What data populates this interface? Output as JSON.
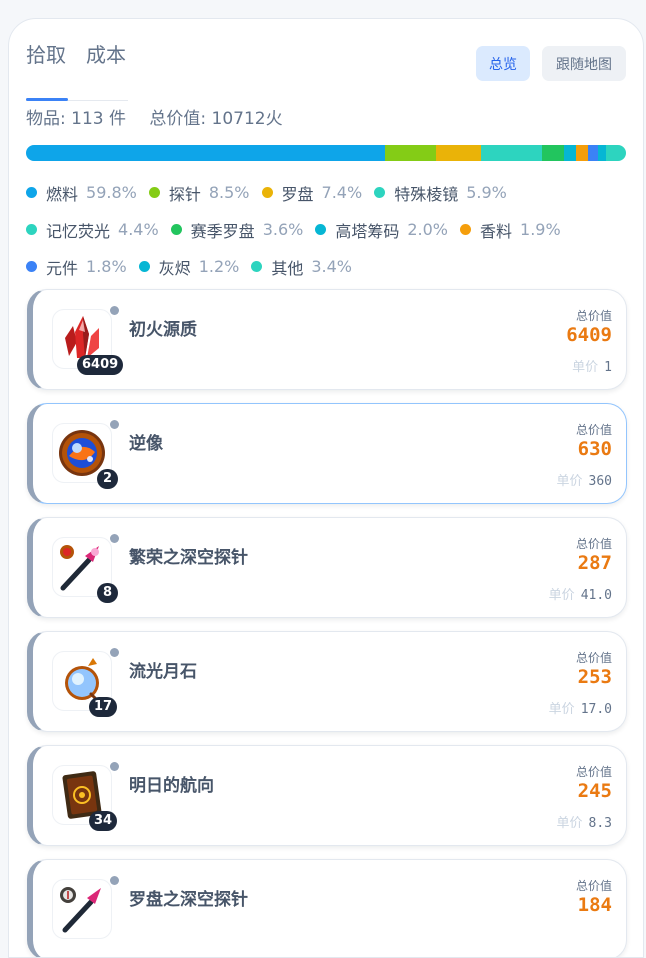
{
  "tabs": [
    {
      "label": "拾取",
      "active": true
    },
    {
      "label": "成本",
      "active": false
    }
  ],
  "buttons": {
    "overview": "总览",
    "follow_map": "跟随地图"
  },
  "summary": {
    "items_text": "物品: 113 件",
    "total_text": "总价值: 10712火"
  },
  "composition": [
    {
      "label": "燃料",
      "pct": "59.8%",
      "value": 59.8,
      "color": "#0ea5e9"
    },
    {
      "label": "探针",
      "pct": "8.5%",
      "value": 8.5,
      "color": "#84cc16"
    },
    {
      "label": "罗盘",
      "pct": "7.4%",
      "value": 7.4,
      "color": "#eab308"
    },
    {
      "label": "特殊棱镜",
      "pct": "5.9%",
      "value": 5.9,
      "color": "#2dd4bf"
    },
    {
      "label": "记忆荧光",
      "pct": "4.4%",
      "value": 4.4,
      "color": "#2dd4bf"
    },
    {
      "label": "赛季罗盘",
      "pct": "3.6%",
      "value": 3.6,
      "color": "#22c55e"
    },
    {
      "label": "高塔筹码",
      "pct": "2.0%",
      "value": 2.0,
      "color": "#06b6d4"
    },
    {
      "label": "香料",
      "pct": "1.9%",
      "value": 1.9,
      "color": "#f59e0b"
    },
    {
      "label": "元件",
      "pct": "1.8%",
      "value": 1.8,
      "color": "#3b82f6"
    },
    {
      "label": "灰烬",
      "pct": "1.2%",
      "value": 1.2,
      "color": "#06b6d4"
    },
    {
      "label": "其他",
      "pct": "3.4%",
      "value": 3.4,
      "color": "#2dd4bf"
    }
  ],
  "item_card_labels": {
    "total_value": "总价值",
    "unit_price": "单价"
  },
  "items": [
    {
      "name": "初火源质",
      "qty": "6409",
      "total": "6409",
      "unit": "1",
      "icon": "red-crystal-icon"
    },
    {
      "name": "逆像",
      "qty": "2",
      "total": "630",
      "unit": "360",
      "icon": "mirror-orb-icon"
    },
    {
      "name": "繁荣之深空探针",
      "qty": "8",
      "total": "287",
      "unit": "41.0",
      "icon": "probe-icon"
    },
    {
      "name": "流光月石",
      "qty": "17",
      "total": "253",
      "unit": "17.0",
      "icon": "moonstone-icon"
    },
    {
      "name": "明日的航向",
      "qty": "34",
      "total": "245",
      "unit": "8.3",
      "icon": "tarot-card-icon"
    },
    {
      "name": "罗盘之深空探针",
      "qty": "",
      "total": "184",
      "unit": "",
      "icon": "compass-probe-icon"
    }
  ]
}
